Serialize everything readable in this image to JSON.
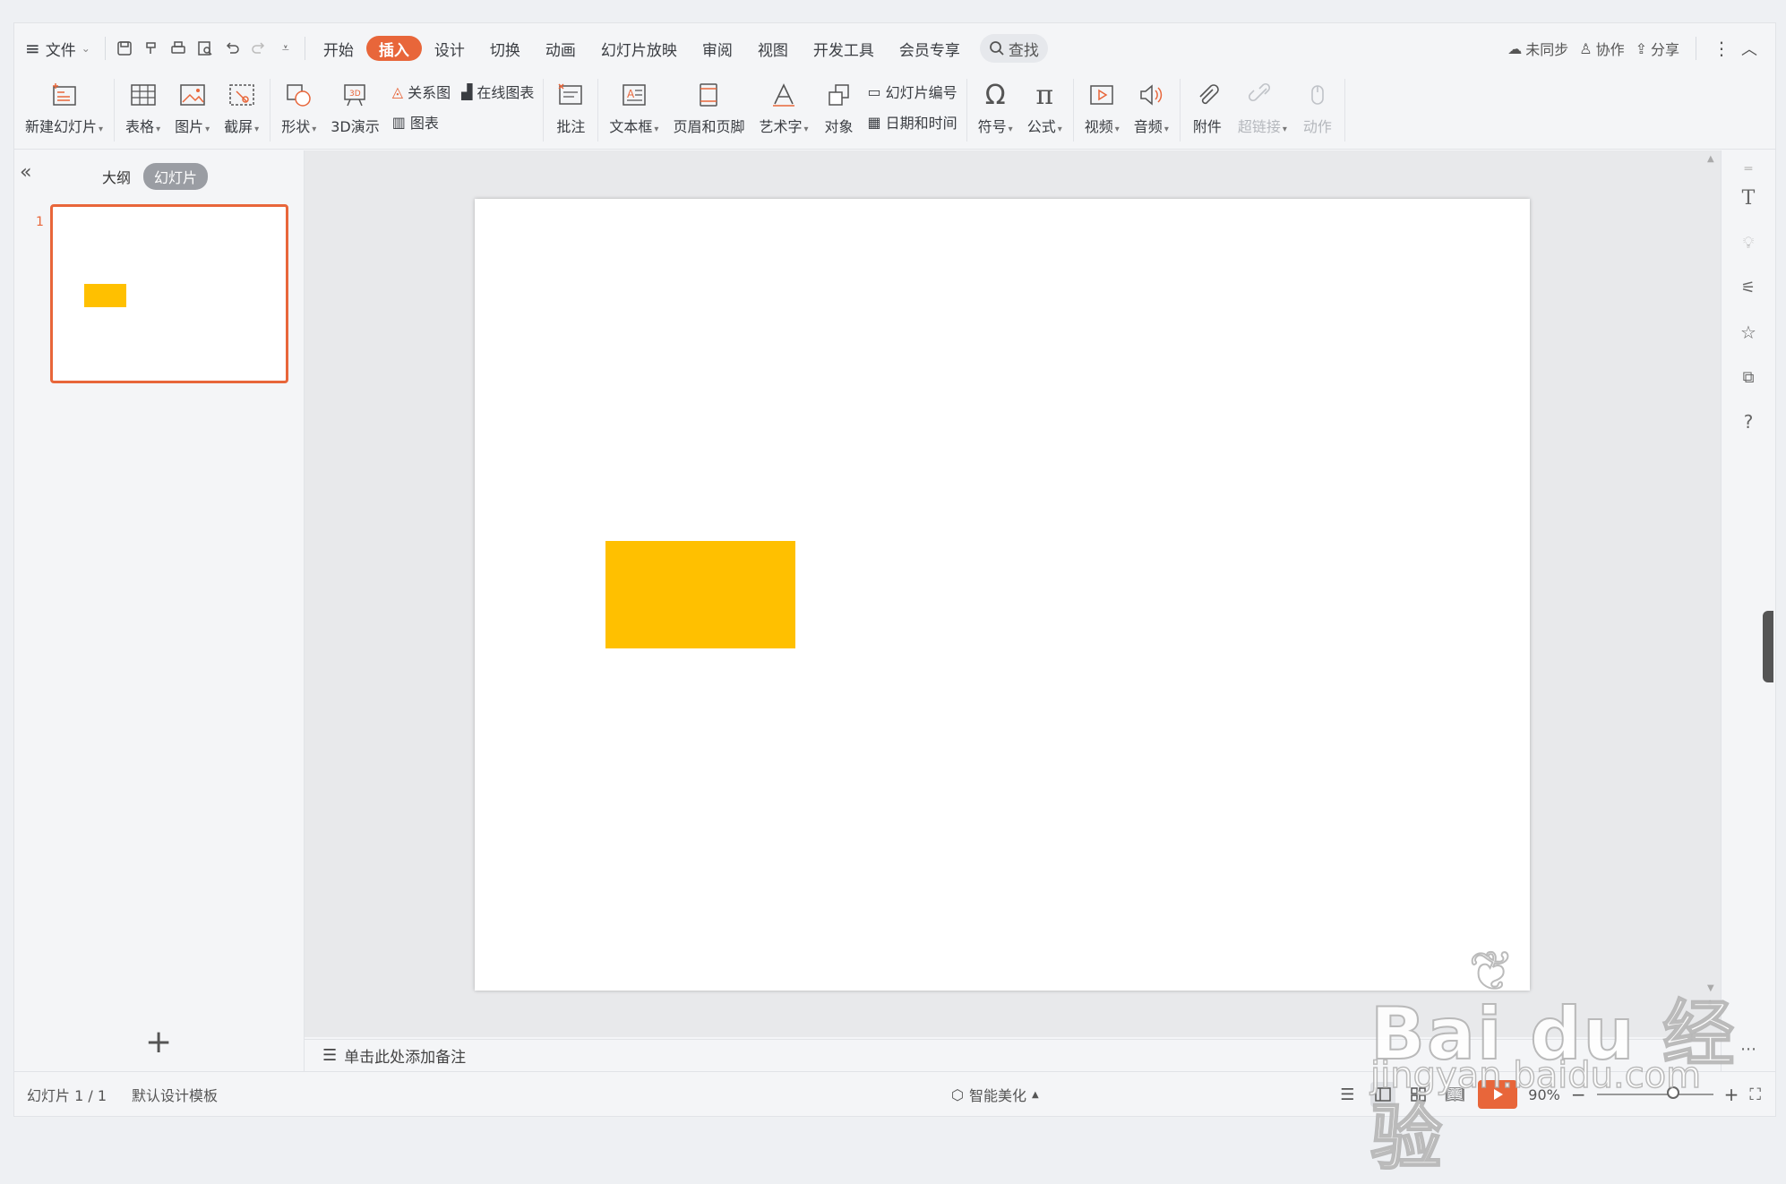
{
  "menu": {
    "file_label": "文件",
    "tabs": [
      "开始",
      "插入",
      "设计",
      "切换",
      "动画",
      "幻灯片放映",
      "审阅",
      "视图",
      "开发工具",
      "会员专享"
    ],
    "active_tab": "插入",
    "search_label": "查找",
    "right": {
      "sync": "未同步",
      "collab": "协作",
      "share": "分享"
    }
  },
  "ribbon": {
    "new_slide": "新建幻灯片",
    "table": "表格",
    "picture": "图片",
    "screenshot": "截屏",
    "shape": "形状",
    "demo3d": "3D演示",
    "relation": "关系图",
    "online_chart": "在线图表",
    "chart": "图表",
    "comment": "批注",
    "textbox": "文本框",
    "header_footer": "页眉和页脚",
    "wordart": "艺术字",
    "object": "对象",
    "slide_number": "幻灯片编号",
    "datetime": "日期和时间",
    "symbol": "符号",
    "formula": "公式",
    "video": "视频",
    "audio": "音频",
    "attachment": "附件",
    "hyperlink": "超链接",
    "action": "动作"
  },
  "left_panel": {
    "tab_outline": "大纲",
    "tab_slides": "幻灯片",
    "slide_number": "1"
  },
  "notes_placeholder": "单击此处添加备注",
  "status": {
    "slide_info": "幻灯片 1 / 1",
    "template": "默认设计模板",
    "beautify": "智能美化",
    "zoom": "90%"
  },
  "colors": {
    "accent": "#e8663a",
    "shape_fill": "#ffc000"
  },
  "watermark": {
    "logo": "Bai du 经验",
    "url": "jingyan.baidu.com"
  }
}
